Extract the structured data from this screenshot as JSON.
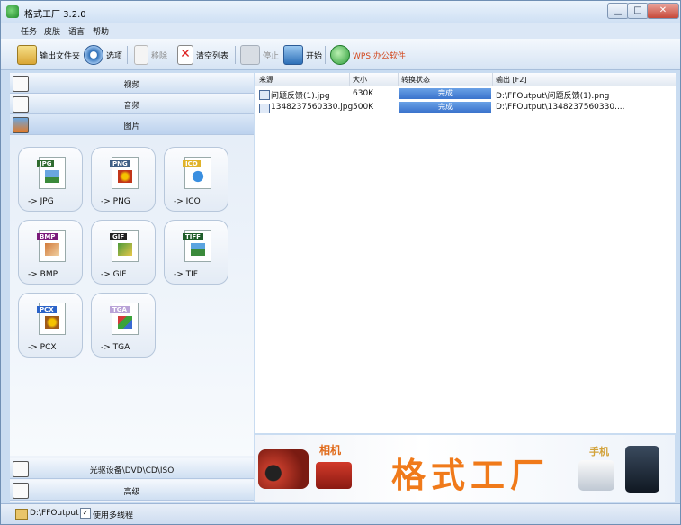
{
  "window": {
    "title": "格式工厂 3.2.0",
    "min": "▁",
    "max": "□",
    "close": "✕"
  },
  "menu": [
    "任务",
    "皮肤",
    "语言",
    "帮助"
  ],
  "toolbar": {
    "output_folder": "输出文件夹",
    "options": "选项",
    "remove": "移除",
    "clear_list": "清空列表",
    "stop": "停止",
    "start": "开始",
    "wps": "WPS 办公软件"
  },
  "categories": {
    "video": "视频",
    "audio": "音频",
    "image": "图片",
    "rom": "光驱设备\\DVD\\CD\\ISO",
    "advanced": "高级"
  },
  "image_tiles": [
    {
      "tag": "JPG",
      "label": "-> JPG",
      "tag_color": "#2f6b2f"
    },
    {
      "tag": "PNG",
      "label": "-> PNG",
      "tag_color": "#3f5f85"
    },
    {
      "tag": "ICO",
      "label": "-> ICO",
      "tag_color": "#e0b32a"
    },
    {
      "tag": "BMP",
      "label": "-> BMP",
      "tag_color": "#7a1b7a"
    },
    {
      "tag": "GIF",
      "label": "-> GIF",
      "tag_color": "#222222"
    },
    {
      "tag": "TIFF",
      "label": "-> TIF",
      "tag_color": "#1f5d2a"
    },
    {
      "tag": "PCX",
      "label": "-> PCX",
      "tag_color": "#2b63c9"
    },
    {
      "tag": "TGA",
      "label": "-> TGA",
      "tag_color": "#b9a3d8"
    }
  ],
  "table": {
    "headers": [
      "来源",
      "大小",
      "转换状态",
      "输出 [F2]"
    ],
    "rows": [
      {
        "source": "问题反馈(1).jpg",
        "size": "630K",
        "status": "完成",
        "output": "D:\\FFOutput\\问题反馈(1).png"
      },
      {
        "source": "1348237560330.jpg",
        "size": "500K",
        "status": "完成",
        "output": "D:\\FFOutput\\1348237560330...."
      }
    ]
  },
  "banner": {
    "camera": "相机",
    "brand": "格式工厂",
    "phone": "手机"
  },
  "statusbar": {
    "output_path": "D:\\FFOutput",
    "multithread_label": "使用多线程",
    "multithread_checked": true,
    "check_mark": "✓"
  },
  "colors": {
    "accent": "#3a73cc",
    "banner_brand": "#f07a1a"
  }
}
